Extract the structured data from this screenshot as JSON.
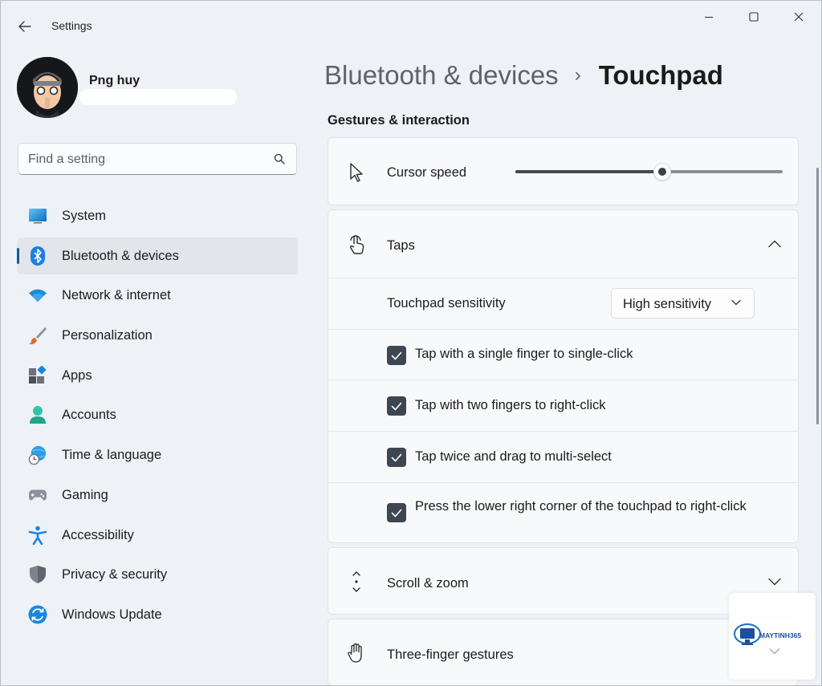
{
  "app": {
    "title": "Settings",
    "back_icon": "arrow-left-icon"
  },
  "window_controls": [
    "minimize-icon",
    "maximize-icon",
    "close-icon"
  ],
  "profile": {
    "name": "Png huy"
  },
  "search": {
    "placeholder": "Find a setting",
    "value": ""
  },
  "sidebar": {
    "items": [
      {
        "label": "System",
        "icon": "system-icon",
        "active": false
      },
      {
        "label": "Bluetooth & devices",
        "icon": "bluetooth-icon",
        "active": true
      },
      {
        "label": "Network & internet",
        "icon": "wifi-icon",
        "active": false
      },
      {
        "label": "Personalization",
        "icon": "brush-icon",
        "active": false
      },
      {
        "label": "Apps",
        "icon": "apps-icon",
        "active": false
      },
      {
        "label": "Accounts",
        "icon": "person-icon",
        "active": false
      },
      {
        "label": "Time & language",
        "icon": "globe-clock-icon",
        "active": false
      },
      {
        "label": "Gaming",
        "icon": "gamepad-icon",
        "active": false
      },
      {
        "label": "Accessibility",
        "icon": "accessibility-icon",
        "active": false
      },
      {
        "label": "Privacy & security",
        "icon": "shield-icon",
        "active": false
      },
      {
        "label": "Windows Update",
        "icon": "update-icon",
        "active": false
      }
    ]
  },
  "breadcrumb": {
    "parent": "Bluetooth & devices",
    "separator": "›",
    "current": "Touchpad"
  },
  "section": {
    "title": "Gestures & interaction"
  },
  "cursor_speed": {
    "label": "Cursor speed",
    "value_fraction": 0.55
  },
  "taps": {
    "label": "Taps",
    "expanded": true,
    "sensitivity_label": "Touchpad sensitivity",
    "sensitivity_value": "High sensitivity",
    "options": [
      {
        "label": "Tap with a single finger to single-click",
        "checked": true
      },
      {
        "label": "Tap with two fingers to right-click",
        "checked": true
      },
      {
        "label": "Tap twice and drag to multi-select",
        "checked": true
      },
      {
        "label": "Press the lower right corner of the touchpad to right-click",
        "checked": true
      }
    ]
  },
  "scroll_zoom": {
    "label": "Scroll & zoom",
    "expanded": false
  },
  "three_finger": {
    "label": "Three-finger gestures"
  },
  "watermark": {
    "text": "MAYTINH365"
  },
  "colors": {
    "accent": "#0a5cad",
    "checkbox": "#3d4651",
    "window_bg": "#eef1f6",
    "card_bg": "#f8f9fb"
  }
}
